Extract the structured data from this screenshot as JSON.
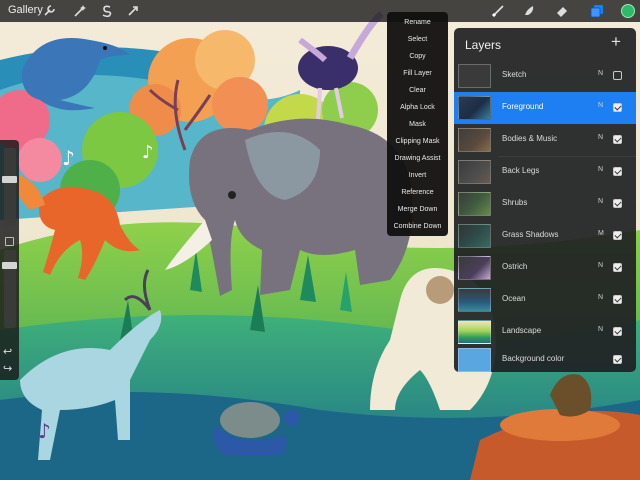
{
  "toolbar": {
    "gallery_label": "Gallery",
    "left_tools": [
      "wrench-icon",
      "magic-wand-icon",
      "selection-icon",
      "transform-icon"
    ],
    "right_tools": [
      "brush-icon",
      "smudge-icon",
      "eraser-icon",
      "layers-icon"
    ],
    "active_color": "#2dbb6a"
  },
  "sidebar": {
    "undo_glyph": "↩",
    "redo_glyph": "↪"
  },
  "context_menu": {
    "items": [
      "Rename",
      "Select",
      "Copy",
      "Fill Layer",
      "Clear",
      "Alpha Lock",
      "Mask",
      "Clipping Mask",
      "Drawing Assist",
      "Invert",
      "Reference",
      "Merge Down",
      "Combine Down"
    ]
  },
  "layers_panel": {
    "title": "Layers",
    "add_glyph": "+",
    "layers": [
      {
        "name": "Sketch",
        "blend": "N",
        "visible": false,
        "active": false
      },
      {
        "name": "Foreground",
        "blend": "N",
        "visible": true,
        "active": true
      },
      {
        "name": "Bodies & Music",
        "blend": "N",
        "visible": true,
        "active": false
      },
      {
        "name": "Back Legs",
        "blend": "N",
        "visible": true,
        "active": false
      },
      {
        "name": "Shrubs",
        "blend": "N",
        "visible": true,
        "active": false
      },
      {
        "name": "Grass Shadows",
        "blend": "M",
        "visible": true,
        "active": false
      },
      {
        "name": "Ostrich",
        "blend": "N",
        "visible": true,
        "active": false
      },
      {
        "name": "Ocean",
        "blend": "N",
        "visible": true,
        "active": false
      },
      {
        "name": "Landscape",
        "blend": "N",
        "visible": true,
        "active": false
      },
      {
        "name": "Background color",
        "blend": "",
        "visible": true,
        "active": false
      }
    ]
  },
  "colors": {
    "accent": "#1e7ff2",
    "panel": "#202124"
  }
}
